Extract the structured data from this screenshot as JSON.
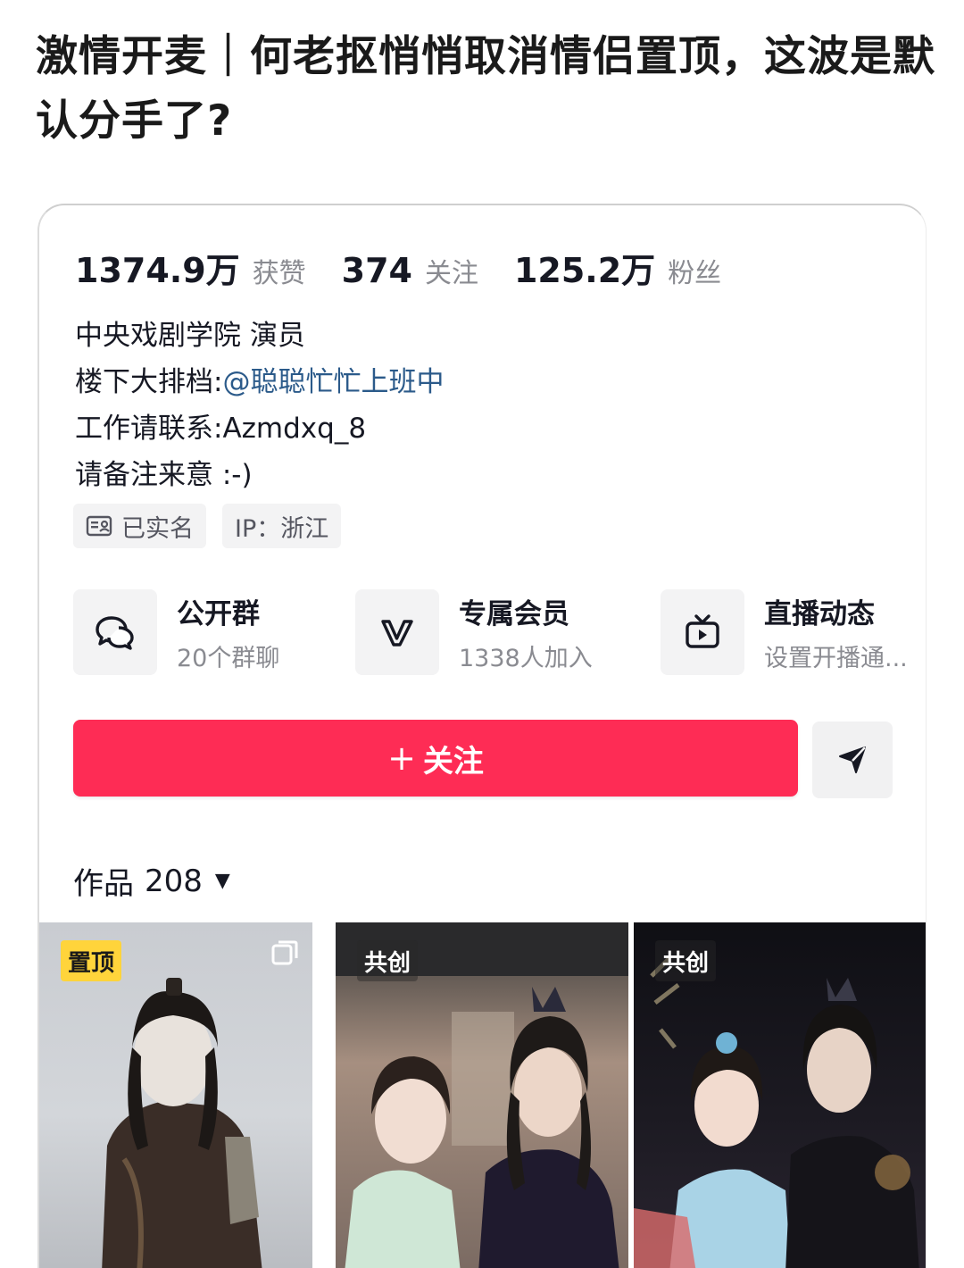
{
  "headline": "激情开麦｜何老抠悄悄取消情侣置顶，这波是默认分手了?",
  "stats": [
    {
      "value": "1374.9万",
      "label": "获赞"
    },
    {
      "value": "374",
      "label": "关注"
    },
    {
      "value": "125.2万",
      "label": "粉丝"
    }
  ],
  "bio": {
    "line1": "中央戏剧学院 演员",
    "line2_prefix": "楼下大排档:",
    "line2_mention": "@聪聪忙忙上班中",
    "line3": "工作请联系:Azmdxq_8",
    "line4": "请备注来意 :-)"
  },
  "tags": {
    "verified": "已实名",
    "ip": "IP：浙江"
  },
  "features": [
    {
      "icon": "group-chat-icon",
      "title": "公开群",
      "subtitle": "20个群聊"
    },
    {
      "icon": "vip-icon",
      "title": "专属会员",
      "subtitle": "1338人加入"
    },
    {
      "icon": "live-tv-icon",
      "title": "直播动态",
      "subtitle": "设置开播通..."
    }
  ],
  "actions": {
    "follow_plus": "+",
    "follow_label": "关注",
    "share_icon": "share-arrow-icon"
  },
  "works": {
    "label": "作品",
    "count": "208"
  },
  "thumbnails": [
    {
      "badge": "置顶"
    },
    {
      "badge": "共创"
    },
    {
      "badge": "共创"
    }
  ],
  "colors": {
    "follow_button": "#fe2c55",
    "pinned_badge": "#ffd43b",
    "mention": "#2b5a8a"
  }
}
